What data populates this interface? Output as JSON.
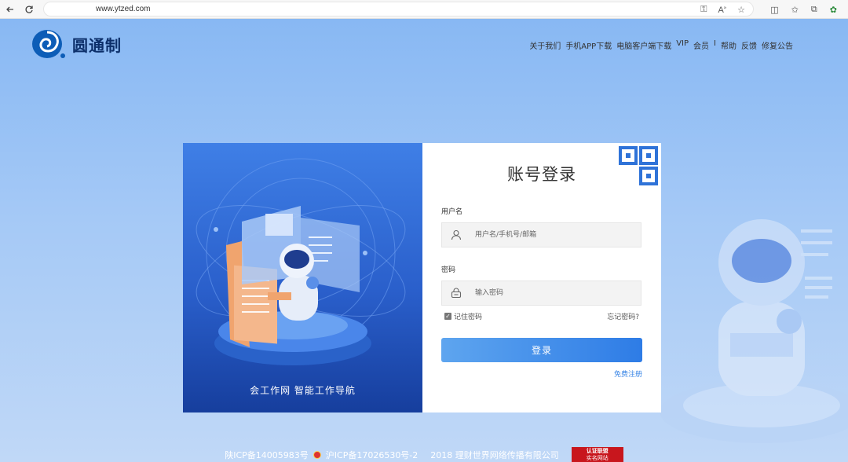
{
  "browser": {
    "url": "www.ytzed.com"
  },
  "header": {
    "logo_text": "圆通制",
    "nav": [
      "关于我们",
      "手机APP下载",
      "电脑客户端下载",
      "VIP",
      "会员",
      "I",
      "帮助",
      "反馈",
      "修复公告"
    ]
  },
  "promo": {
    "caption": "会工作网   智能工作导航"
  },
  "login": {
    "title": "账号登录",
    "username_label": "用户名",
    "username_placeholder": "用户名/手机号/邮箱",
    "password_label": "密码",
    "password_placeholder": "输入密码",
    "remember_label": "记住密码",
    "forgot_label": "忘记密码?",
    "submit_label": "登录",
    "register_label": "免费注册"
  },
  "footer": {
    "icp1": "陕ICP备14005983号",
    "icp2": "沪ICP备17026530号-2",
    "copyright": "2018 理财世界网络传播有限公司",
    "badge_line1": "认证联盟",
    "badge_line2": "实名网站"
  },
  "colors": {
    "accent": "#2e7ce6",
    "page_bg": "#9fc4f5",
    "panel_blue": "#2a5fcb"
  }
}
